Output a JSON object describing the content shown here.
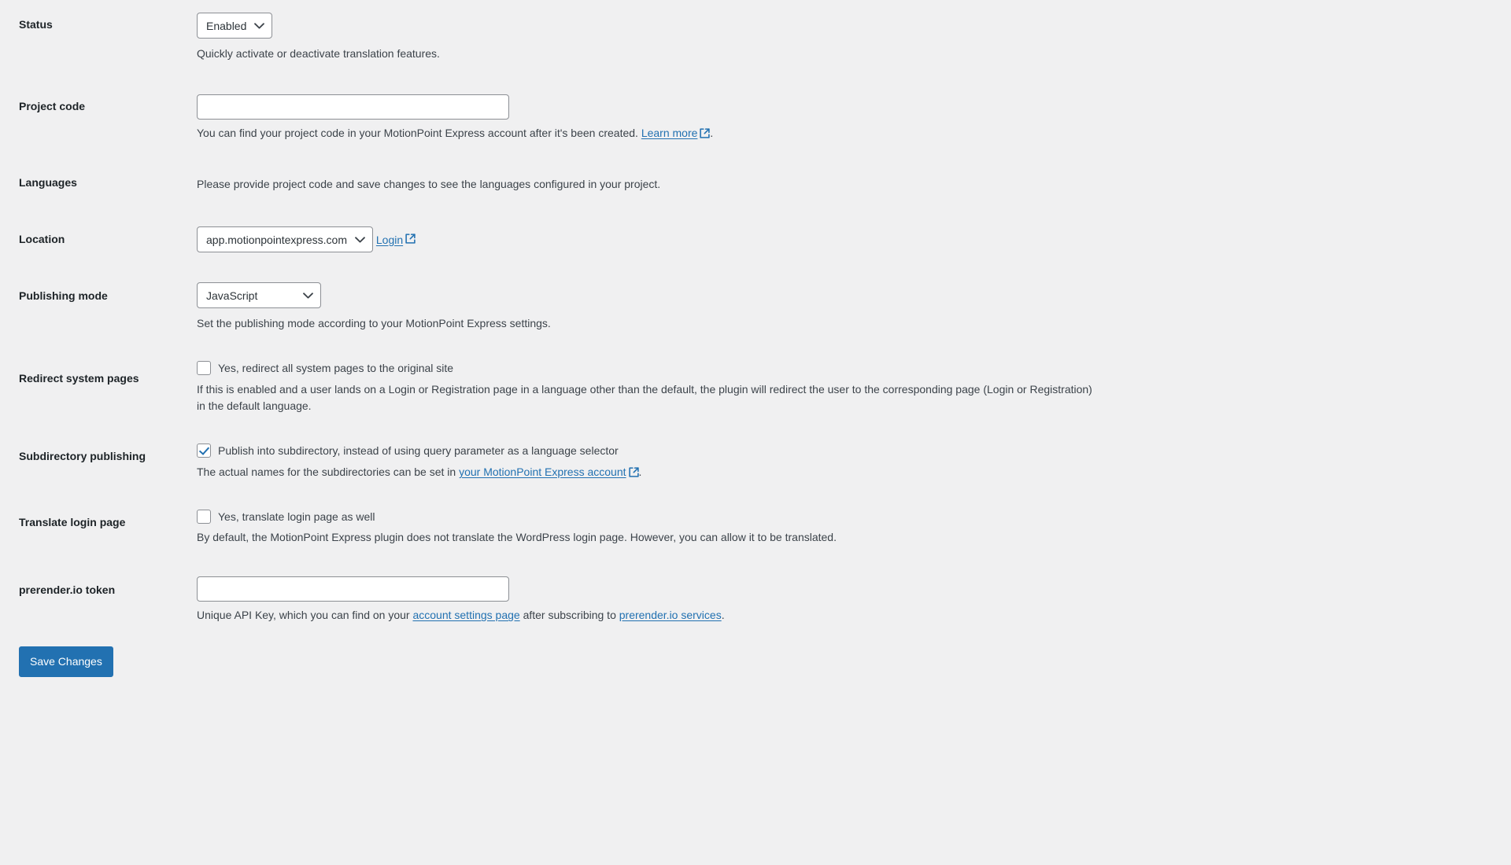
{
  "colors": {
    "page_background": "#f0f0f1",
    "label_text": "#1d2327",
    "body_text": "#3c434a",
    "link": "#2271b1",
    "accent_button": "#2271b1",
    "control_border": "#8c8f94",
    "checkbox_check": "#2271b1"
  },
  "rows": {
    "status": {
      "label": "Status",
      "select_value": "Enabled",
      "description": "Quickly activate or deactivate translation features."
    },
    "project_code": {
      "label": "Project code",
      "input_value": "",
      "input_placeholder": "",
      "description_before": "You can find your project code in your MotionPoint Express account after it's been created. ",
      "link_text": "Learn more",
      "description_after": "."
    },
    "languages": {
      "label": "Languages",
      "description": "Please provide project code and save changes to see the languages configured in your project."
    },
    "location": {
      "label": "Location",
      "select_value": "app.motionpointexpress.com",
      "login_link_text": "Login"
    },
    "publishing_mode": {
      "label": "Publishing mode",
      "select_value": "JavaScript",
      "description": "Set the publishing mode according to your MotionPoint Express settings."
    },
    "redirect_system_pages": {
      "label": "Redirect system pages",
      "checked": false,
      "checkbox_label": "Yes, redirect all system pages to the original site",
      "description": "If this is enabled and a user lands on a Login or Registration page in a language other than the default, the plugin will redirect the user to the corresponding page (Login or Registration) in the default language."
    },
    "subdirectory_publishing": {
      "label": "Subdirectory publishing",
      "checked": true,
      "checkbox_label": "Publish into subdirectory, instead of using query parameter as a language selector",
      "description_before": "The actual names for the subdirectories can be set in ",
      "link_text": "your MotionPoint Express account",
      "description_after": "."
    },
    "translate_login_page": {
      "label": "Translate login page",
      "checked": false,
      "checkbox_label": "Yes, translate login page as well",
      "description": "By default, the MotionPoint Express plugin does not translate the WordPress login page. However, you can allow it to be translated."
    },
    "prerender_token": {
      "label": "prerender.io token",
      "input_value": "",
      "input_placeholder": "",
      "description_part1": "Unique API Key, which you can find on your ",
      "link1_text": "account settings page",
      "description_part2": " after subscribing to ",
      "link2_text": "prerender.io services",
      "description_part3": "."
    }
  },
  "submit": {
    "save_label": "Save Changes"
  },
  "icons": {
    "external_link": "external-link-icon",
    "chevron_down": "chevron-down-icon",
    "checkmark": "checkmark-icon"
  }
}
